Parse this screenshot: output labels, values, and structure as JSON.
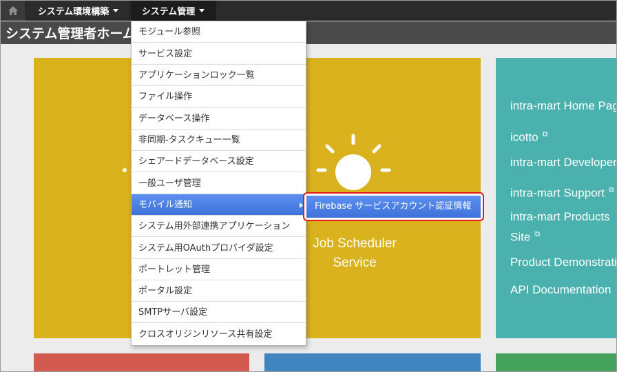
{
  "nav": {
    "home_icon": "home-icon",
    "menus": [
      {
        "label": "システム環境構築"
      },
      {
        "label": "システム管理"
      }
    ]
  },
  "page": {
    "title": "システム管理者ホーム"
  },
  "dropdown": {
    "items": [
      {
        "label": "モジュール参照"
      },
      {
        "label": "サービス設定"
      },
      {
        "label": "アプリケーションロック一覧"
      },
      {
        "label": "ファイル操作"
      },
      {
        "label": "データベース操作"
      },
      {
        "label": "非同期-タスクキュー一覧"
      },
      {
        "label": "シェアードデータベース設定"
      },
      {
        "label": "一般ユーザ管理"
      },
      {
        "label": "モバイル通知"
      },
      {
        "label": "システム用外部連携アプリケーション"
      },
      {
        "label": "システム用OAuthプロバイダ設定"
      },
      {
        "label": "ポートレット管理"
      },
      {
        "label": "ポータル設定"
      },
      {
        "label": "SMTPサーバ設定"
      },
      {
        "label": "クロスオリジンリソース共有設定"
      }
    ],
    "active_label": "モバイル通知"
  },
  "submenu": {
    "label": "Firebase サービスアカウント認証情報"
  },
  "tiles": {
    "job_scheduler": {
      "line1": "Job Scheduler",
      "line2": "Service",
      "icon": "sun-icon"
    },
    "links": [
      {
        "label": "intra-mart Home Page"
      },
      {
        "label": "icotto",
        "external": true
      },
      {
        "label": "intra-mart Developer"
      },
      {
        "label": "intra-mart Support",
        "external": true
      },
      {
        "label": "intra-mart Products"
      },
      {
        "label": "Site",
        "external": true
      },
      {
        "label": "Product Demonstration"
      },
      {
        "label": "API Documentation"
      }
    ]
  },
  "colors": {
    "nav_bg": "#2b2b2b",
    "title_bg": "#4a4a4a",
    "tile_yellow": "#d9b21d",
    "tile_teal": "#4bb1ae",
    "tile_red": "#d35a4f",
    "tile_blue": "#3f86c1",
    "tile_green": "#46a35e",
    "menu_active": "#4a7fe3",
    "highlight_border": "#e0191b"
  }
}
